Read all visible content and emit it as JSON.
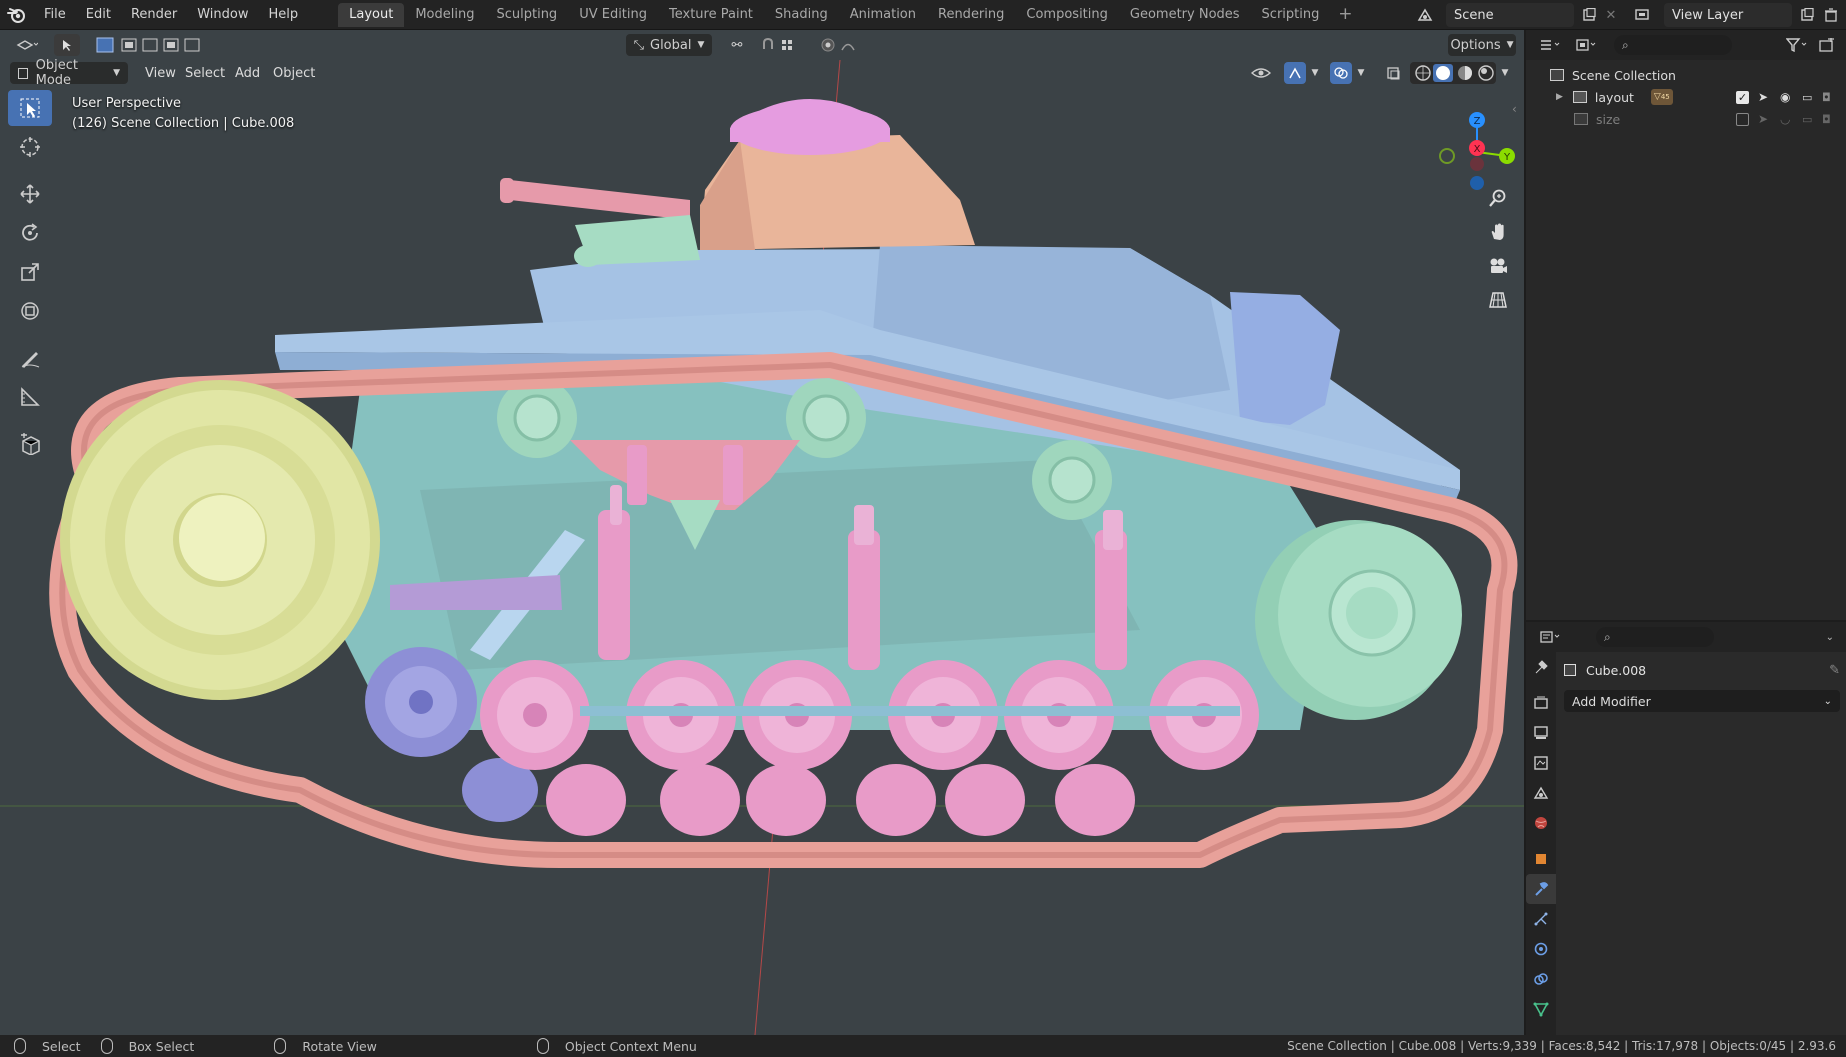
{
  "app": {
    "menus": [
      "File",
      "Edit",
      "Render",
      "Window",
      "Help"
    ]
  },
  "workspaces": {
    "tabs": [
      "Layout",
      "Modeling",
      "Sculpting",
      "UV Editing",
      "Texture Paint",
      "Shading",
      "Animation",
      "Rendering",
      "Compositing",
      "Geometry Nodes",
      "Scripting"
    ],
    "active": "Layout",
    "add_icon": "plus-icon"
  },
  "scene": {
    "name": "Scene"
  },
  "view_layer": {
    "name": "View Layer"
  },
  "viewport": {
    "transform_orientation": "Global",
    "options_label": "Options",
    "mode": "Object Mode",
    "menus": [
      "View",
      "Select",
      "Add",
      "Object"
    ],
    "perspective_label": "User Perspective",
    "collection_info": "(126) Scene Collection | Cube.008",
    "gizmo_axes": {
      "x": "X",
      "y": "Y",
      "z": "Z"
    },
    "colors": {
      "background": "#3b4246",
      "tank_blue": "#a9c6e6",
      "track_pink": "#e8a19a",
      "wheel_pink": "#e89bc8",
      "wheel_green": "#a6dcc3",
      "sprocket_yellow": "#e1e6a5",
      "hull_teal": "#86c1bf",
      "turret_peach": "#e9b59a",
      "cupola_pink": "#e59ce0",
      "idler_blue": "#8d8fd6",
      "axis_x": "#ff3352",
      "axis_y": "#8bdc00",
      "axis_z": "#2890ff"
    }
  },
  "outliner": {
    "root": "Scene Collection",
    "items": [
      {
        "name": "layout",
        "badge": "45",
        "enabled": true
      },
      {
        "name": "size",
        "enabled": false
      }
    ]
  },
  "properties": {
    "object_name": "Cube.008",
    "add_modifier_label": "Add Modifier"
  },
  "statusbar": {
    "select": "Select",
    "box_select": "Box Select",
    "rotate_view": "Rotate View",
    "context_menu": "Object Context Menu",
    "stats": "Scene Collection | Cube.008 | Verts:9,339 | Faces:8,542 | Tris:17,978 | Objects:0/45 | 2.93.6"
  }
}
